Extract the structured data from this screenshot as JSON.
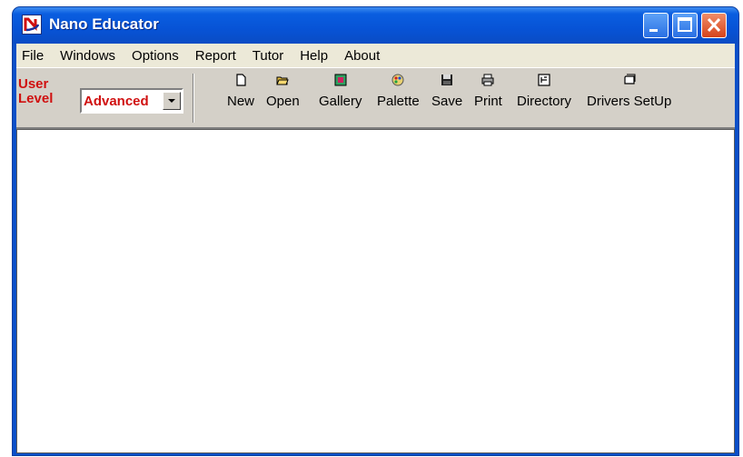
{
  "window": {
    "title": "Nano Educator"
  },
  "menu": [
    {
      "label": "File"
    },
    {
      "label": "Windows"
    },
    {
      "label": "Options"
    },
    {
      "label": "Report"
    },
    {
      "label": "Tutor"
    },
    {
      "label": "Help"
    },
    {
      "label": "About"
    }
  ],
  "toolbar": {
    "user_level": {
      "line1": "User",
      "line2": "Level",
      "value": "Advanced"
    },
    "tools": [
      {
        "label": "New",
        "icon": "new-document-icon"
      },
      {
        "label": "Open",
        "icon": "open-folder-icon"
      },
      {
        "label": "Gallery",
        "icon": "gallery-icon"
      },
      {
        "label": "Palette",
        "icon": "palette-icon"
      },
      {
        "label": "Save",
        "icon": "floppy-disk-icon"
      },
      {
        "label": "Print",
        "icon": "printer-icon"
      },
      {
        "label": "Directory",
        "icon": "directory-icon"
      },
      {
        "label": "Drivers SetUp",
        "icon": "drivers-setup-icon"
      }
    ]
  },
  "colors": {
    "title_bar": "#0753d6",
    "user_level_text": "#d01010",
    "toolbar_bg": "#d4d0c8",
    "menubar_bg": "#ece9d8"
  }
}
